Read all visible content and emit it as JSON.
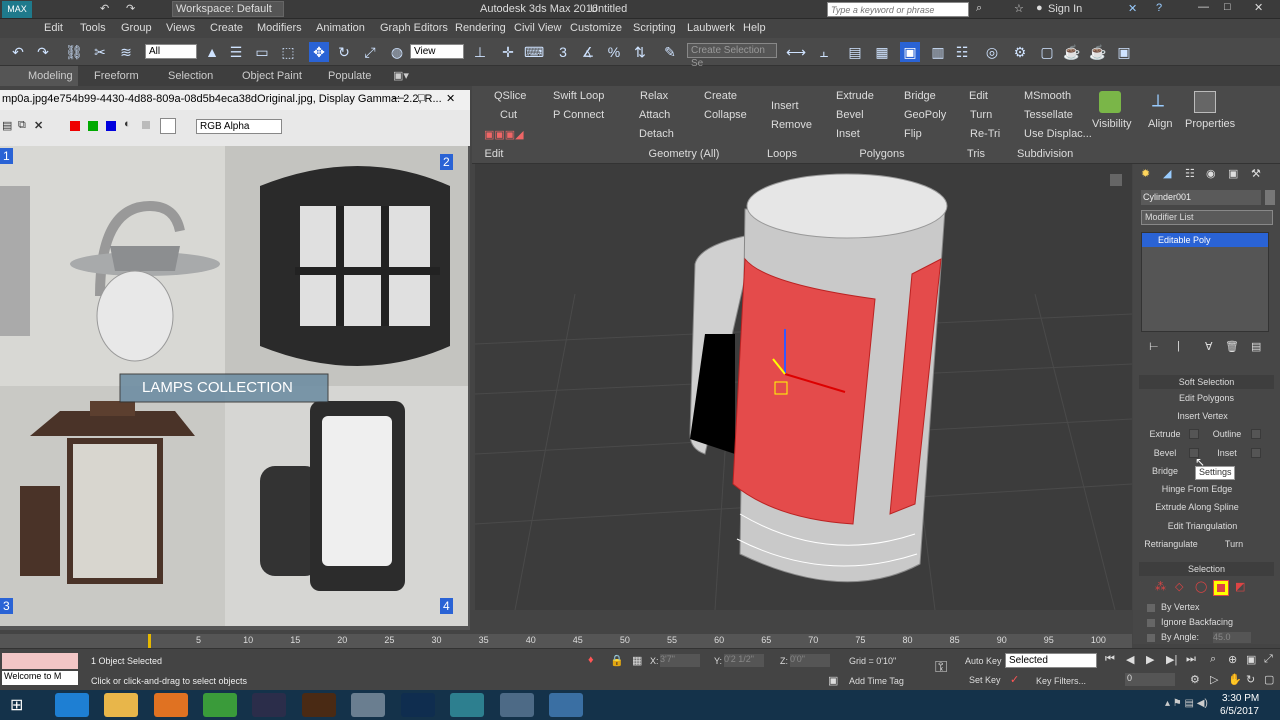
{
  "titlebar": {
    "workspace": "Workspace: Default",
    "app_title": "Autodesk 3ds Max 2016",
    "doc_title": "Untitled",
    "search_placeholder": "Type a keyword or phrase",
    "sign_in": "Sign In"
  },
  "menu": [
    "Edit",
    "Tools",
    "Group",
    "Views",
    "Create",
    "Modifiers",
    "Animation",
    "Graph Editors",
    "Rendering",
    "Civil View",
    "Customize",
    "Scripting",
    "Laubwerk",
    "Help"
  ],
  "toolbar": {
    "filter": "All",
    "refcoord": "View",
    "selection_set": "Create Selection Se"
  },
  "ribbon_tabs": [
    "Modeling",
    "Freeform",
    "Selection",
    "Object Paint",
    "Populate"
  ],
  "ribbon": {
    "edit": {
      "qslice": "QSlice",
      "swift_loop": "Swift Loop",
      "cut": "Cut",
      "p_connect": "P Connect",
      "label": "Edit"
    },
    "geometry": {
      "relax": "Relax",
      "create": "Create",
      "attach": "Attach",
      "collapse": "Collapse",
      "detach": "Detach",
      "label": "Geometry (All)"
    },
    "loops": {
      "insert": "Insert",
      "remove": "Remove",
      "label": "Loops"
    },
    "polygons": {
      "extrude": "Extrude",
      "bridge": "Bridge",
      "bevel": "Bevel",
      "geopoly": "GeoPoly",
      "inset": "Inset",
      "flip": "Flip",
      "label": "Polygons"
    },
    "tris": {
      "edit": "Edit",
      "turn": "Turn",
      "retri": "Re-Tri",
      "label": "Tris"
    },
    "subdivision": {
      "msmooth": "MSmooth",
      "tessellate": "Tessellate",
      "use_displac": "Use Displac...",
      "label": "Subdivision"
    },
    "visibility": "Visibility",
    "align": "Align",
    "properties": "Properties"
  },
  "image_window": {
    "title": "mp0a.jpg4e754b99-4430-4d88-809a-08d5b4eca38dOriginal.jpg, Display Gamma: 2.2, R...",
    "channel": "RGB Alpha",
    "caption": "LAMPS COLLECTION",
    "quadrants": [
      "1",
      "2",
      "3",
      "4"
    ]
  },
  "command_panel": {
    "object_name": "Cylinder001",
    "modifier_list": "Modifier List",
    "stack_item": "Editable Poly",
    "rollouts": {
      "soft_selection": "Soft Selection",
      "edit_polygons": "Edit Polygons",
      "selection": "Selection"
    },
    "buttons": {
      "insert_vertex": "Insert Vertex",
      "extrude": "Extrude",
      "outline": "Outline",
      "bevel": "Bevel",
      "inset": "Inset",
      "bridge": "Bridge",
      "settings_tip": "Settings",
      "hinge": "Hinge From Edge",
      "extrude_spline": "Extrude Along Spline",
      "edit_tri": "Edit Triangulation",
      "retriangulate": "Retriangulate",
      "turn": "Turn"
    },
    "checks": {
      "by_vertex": "By Vertex",
      "ignore_backfacing": "Ignore Backfacing",
      "by_angle": "By Angle:",
      "angle_value": "45.0"
    }
  },
  "timeline": {
    "ticks": [
      "5",
      "10",
      "15",
      "20",
      "25",
      "30",
      "35",
      "40",
      "45",
      "50",
      "55",
      "60",
      "65",
      "70",
      "75",
      "80",
      "85",
      "90",
      "95",
      "100"
    ]
  },
  "status": {
    "welcome": "Welcome to M",
    "objects_selected": "1 Object Selected",
    "prompt": "Click or click-and-drag to select objects",
    "x_label": "X:",
    "x_value": "3'7\"",
    "y_label": "Y:",
    "y_value": "0'2 1/2\"",
    "z_label": "Z:",
    "z_value": "0'0\"",
    "grid": "Grid = 0'10\"",
    "add_time_tag": "Add Time Tag",
    "auto_key": "Auto Key",
    "set_key": "Set Key",
    "key_mode": "Selected",
    "key_filters": "Key Filters...",
    "frame": "0"
  },
  "taskbar": {
    "time": "3:30 PM",
    "date": "6/5/2017"
  },
  "colors": {
    "accent": "#d83b3b",
    "selected_blue": "#2a63d5",
    "viewport_bg": "#3c3c3c"
  }
}
